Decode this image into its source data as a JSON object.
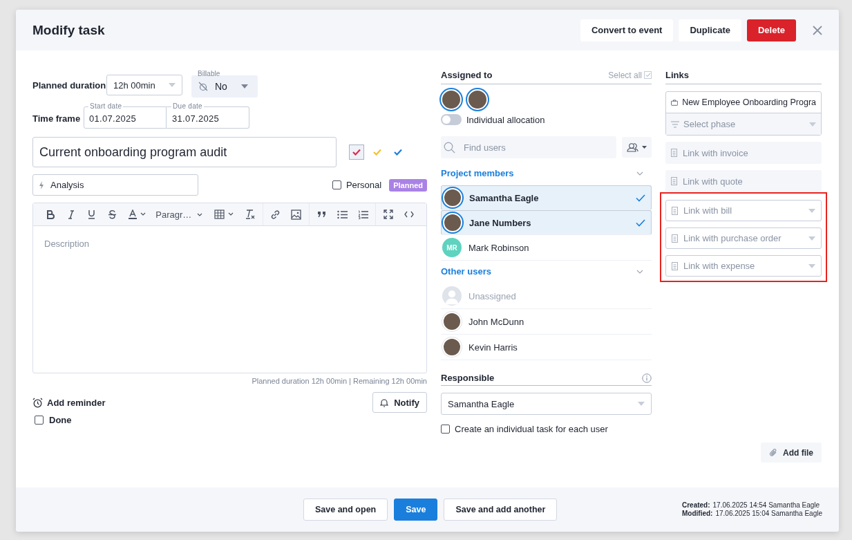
{
  "dialog": {
    "title": "Modify task",
    "actions": [
      {
        "label": "Convert to event",
        "kind": "secondary"
      },
      {
        "label": "Duplicate",
        "kind": "secondary"
      },
      {
        "label": "Delete",
        "kind": "danger"
      }
    ]
  },
  "planned_duration": {
    "label": "Planned duration",
    "value": "12h 00min"
  },
  "billable": {
    "label": "Billable",
    "value": "No"
  },
  "time_frame": {
    "label": "Time frame",
    "start_label": "Start date",
    "start": "01.07.2025",
    "due_label": "Due date",
    "due": "31.07.2025"
  },
  "task_name": "Current onboarding program audit",
  "colors": [
    {
      "color": "#e0284a",
      "selected": true
    },
    {
      "color": "#f5c02a",
      "selected": false
    },
    {
      "color": "#1a7fdc",
      "selected": false
    }
  ],
  "activity": "Analysis",
  "personal": {
    "label": "Personal",
    "checked": false
  },
  "status_badge": "Planned",
  "editor": {
    "paragraph": "Paragr…",
    "placeholder": "Description",
    "footer": "Planned duration 12h 00min | Remaining 12h 00min"
  },
  "reminder": "Add reminder",
  "notify": "Notify",
  "done": {
    "label": "Done",
    "checked": false
  },
  "assigned": {
    "title": "Assigned to",
    "select_all": "Select all",
    "select_all_checked": true,
    "individual_allocation": {
      "label": "Individual allocation",
      "on": false
    },
    "search_placeholder": "Find users"
  },
  "groups": [
    {
      "title": "Project members",
      "users": [
        {
          "name": "Samantha Eagle",
          "kind": "photo",
          "selected": true,
          "muted": false
        },
        {
          "name": "Jane Numbers",
          "kind": "photo",
          "selected": true,
          "muted": false
        },
        {
          "name": "Mark Robinson",
          "kind": "initials",
          "initials": "MR",
          "color": "#5ed3bf",
          "selected": false,
          "muted": false
        }
      ]
    },
    {
      "title": "Other users",
      "users": [
        {
          "name": "Unassigned",
          "kind": "blank",
          "selected": false,
          "muted": true
        },
        {
          "name": "John McDunn",
          "kind": "photo",
          "selected": false,
          "muted": false
        },
        {
          "name": "Kevin Harris",
          "kind": "photo",
          "selected": false,
          "muted": false
        }
      ]
    }
  ],
  "responsible": {
    "label": "Responsible",
    "value": "Samantha Eagle"
  },
  "individual_task": {
    "label": "Create an individual task for each user",
    "checked": false
  },
  "links": {
    "title": "Links",
    "project": "New Employee Onboarding Progra",
    "phase_placeholder": "Select phase",
    "items": [
      {
        "label": "Link with invoice",
        "kind": "plain",
        "highlighted": false
      },
      {
        "label": "Link with quote",
        "kind": "plain",
        "highlighted": false
      },
      {
        "label": "Link with bill",
        "kind": "dropdown",
        "highlighted": true
      },
      {
        "label": "Link with purchase order",
        "kind": "dropdown",
        "highlighted": true
      },
      {
        "label": "Link with expense",
        "kind": "dropdown",
        "highlighted": true
      }
    ]
  },
  "add_file": "Add file",
  "footer": {
    "buttons": [
      {
        "label": "Save and open",
        "kind": "secondary"
      },
      {
        "label": "Save",
        "kind": "primary"
      },
      {
        "label": "Save and add another",
        "kind": "secondary"
      }
    ],
    "meta": [
      {
        "label": "Created:",
        "value": "17.06.2025 14:54 Samantha Eagle"
      },
      {
        "label": "Modified:",
        "value": "17.06.2025 15:04 Samantha Eagle"
      }
    ]
  }
}
